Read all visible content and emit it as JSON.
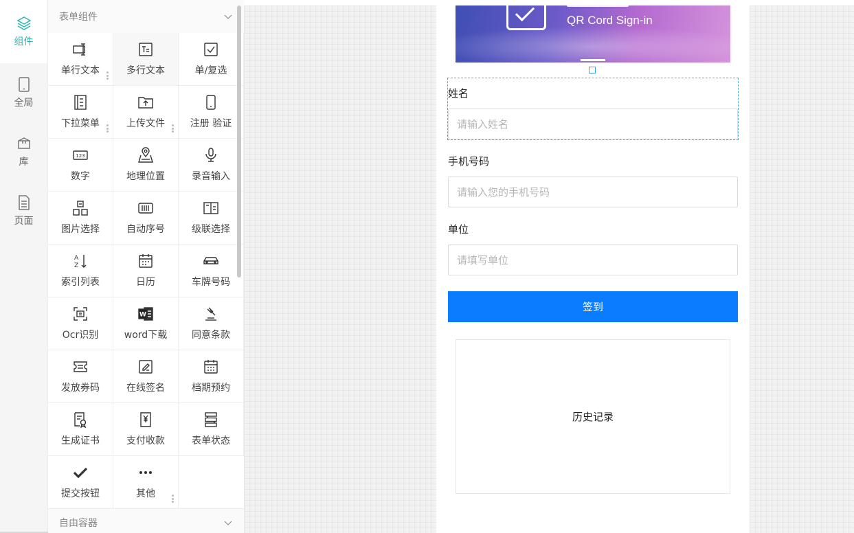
{
  "rail": {
    "items": [
      {
        "label": "组件",
        "icon": "layers-icon",
        "active": true
      },
      {
        "label": "全局",
        "icon": "tablet-icon",
        "active": false
      },
      {
        "label": "库",
        "icon": "box-icon",
        "active": false
      },
      {
        "label": "页面",
        "icon": "document-icon",
        "active": false
      }
    ]
  },
  "panel": {
    "section_title": "表单组件",
    "bottom_section_title": "自由容器",
    "components": [
      {
        "label": "单行文本",
        "icon": "text-input-icon"
      },
      {
        "label": "多行文本",
        "icon": "textarea-icon"
      },
      {
        "label": "单/复选",
        "icon": "checkbox-icon"
      },
      {
        "label": "下拉菜单",
        "icon": "dropdown-list-icon"
      },
      {
        "label": "上传文件",
        "icon": "upload-folder-icon"
      },
      {
        "label": "注册 验证",
        "icon": "phone-verify-icon"
      },
      {
        "label": "数字",
        "icon": "number-icon"
      },
      {
        "label": "地理位置",
        "icon": "map-pin-icon"
      },
      {
        "label": "录音输入",
        "icon": "microphone-icon"
      },
      {
        "label": "图片选择",
        "icon": "image-grid-icon"
      },
      {
        "label": "自动序号",
        "icon": "barcode-icon"
      },
      {
        "label": "级联选择",
        "icon": "cascade-icon"
      },
      {
        "label": "索引列表",
        "icon": "sort-az-icon"
      },
      {
        "label": "日历",
        "icon": "calendar-icon"
      },
      {
        "label": "车牌号码",
        "icon": "car-icon"
      },
      {
        "label": "Ocr识别",
        "icon": "scan-icon"
      },
      {
        "label": "word下载",
        "icon": "word-icon"
      },
      {
        "label": "同意条款",
        "icon": "gavel-icon"
      },
      {
        "label": "发放券码",
        "icon": "ticket-icon"
      },
      {
        "label": "在线签名",
        "icon": "signature-icon"
      },
      {
        "label": "档期预约",
        "icon": "schedule-icon"
      },
      {
        "label": "生成证书",
        "icon": "certificate-icon"
      },
      {
        "label": "支付收款",
        "icon": "payment-icon"
      },
      {
        "label": "表单状态",
        "icon": "status-icon"
      },
      {
        "label": "提交按钮",
        "icon": "check-icon"
      },
      {
        "label": "其他",
        "icon": "more-icon"
      }
    ]
  },
  "form": {
    "banner_subtitle": "QR Cord Sign-in",
    "fields": [
      {
        "label": "姓名",
        "placeholder": "请输入姓名"
      },
      {
        "label": "手机号码",
        "placeholder": "请输入您的手机号码"
      },
      {
        "label": "单位",
        "placeholder": "请填写单位"
      }
    ],
    "submit_label": "签到",
    "history_label": "历史记录"
  },
  "colors": {
    "accent": "#2bb7b3",
    "submit": "#0a7cff",
    "selection": "#4fa6d8"
  }
}
